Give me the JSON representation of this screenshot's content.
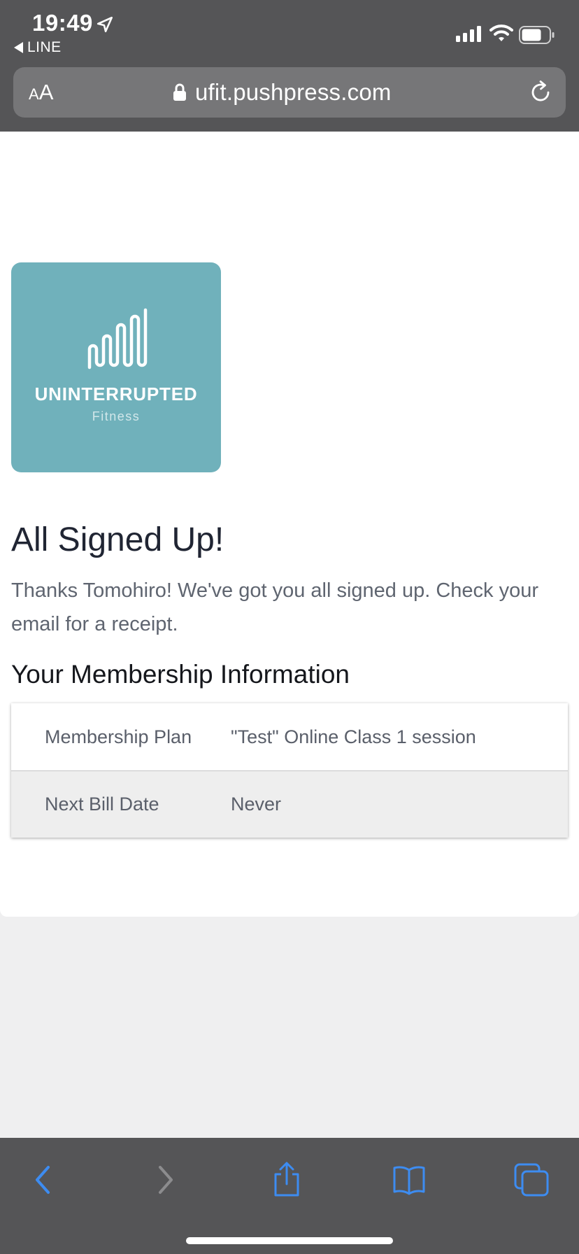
{
  "status_bar": {
    "time": "19:49",
    "back_app_label": "LINE"
  },
  "browser": {
    "text_size_small": "A",
    "text_size_big": "A",
    "url": "ufit.pushpress.com"
  },
  "logo": {
    "wordmark": "UNINTERRUPTED",
    "subtitle": "Fitness",
    "background_color": "#70b1bb"
  },
  "page": {
    "title": "All Signed Up!",
    "message": "Thanks Tomohiro! We've got you all signed up. Check your email for a receipt.",
    "section_title": "Your Membership Information"
  },
  "membership_table": {
    "rows": [
      {
        "label": "Membership Plan",
        "value": "\"Test\" Online Class 1 session"
      },
      {
        "label": "Next Bill Date",
        "value": "Never"
      }
    ]
  },
  "toolbar": {
    "accent_color": "#3d8cf1",
    "disabled_color": "#8c8c8e",
    "buttons": [
      "back-icon",
      "forward-icon",
      "share-icon",
      "bookmarks-icon",
      "tabs-icon"
    ]
  }
}
